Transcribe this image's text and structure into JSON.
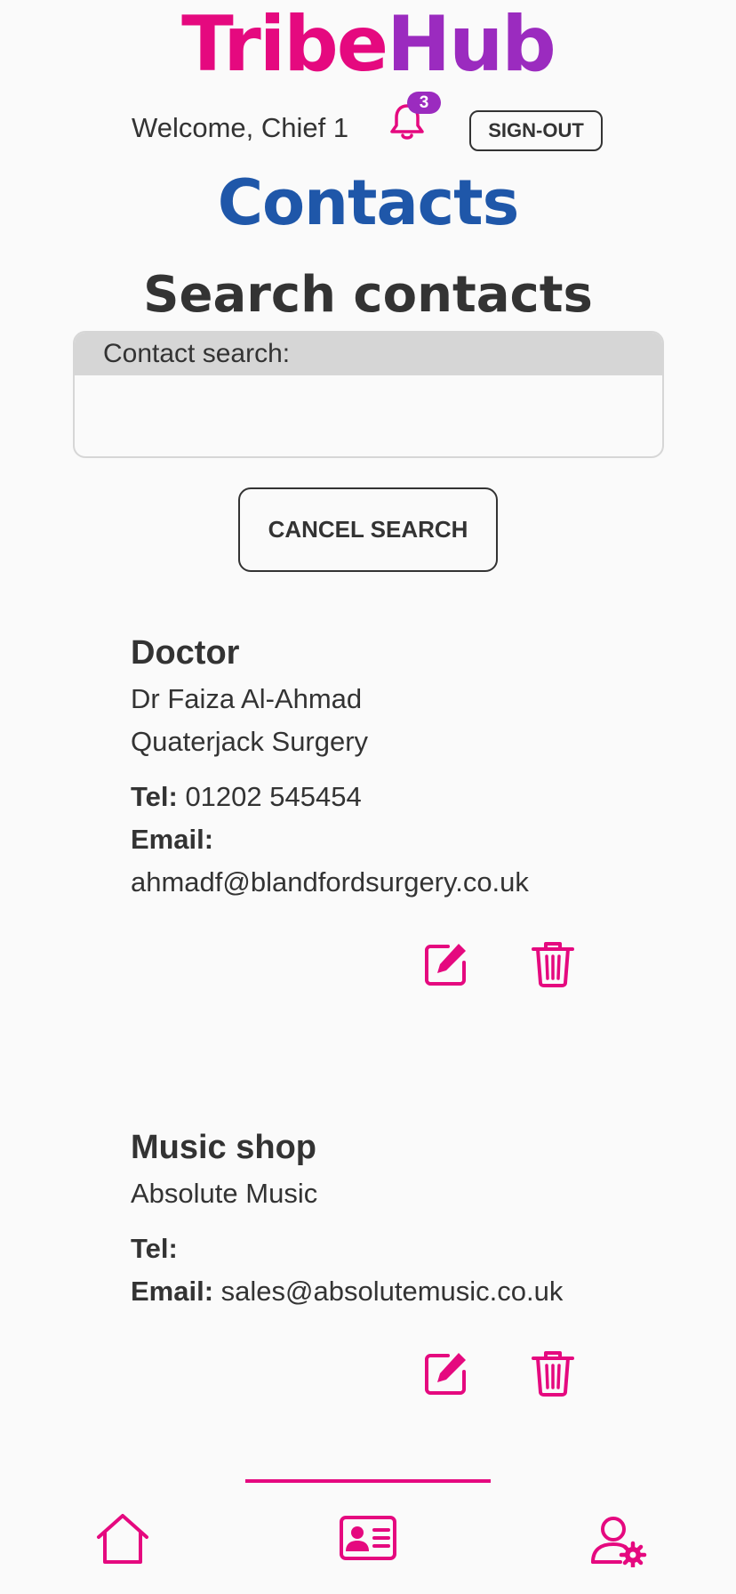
{
  "header": {
    "logo_part1": "Tribe",
    "logo_part2": "Hub",
    "welcome": "Welcome, Chief 1",
    "notification_count": "3",
    "signout_label": "SIGN-OUT"
  },
  "page": {
    "title": "Contacts",
    "subtitle": "Search contacts"
  },
  "search": {
    "label": "Contact search:",
    "value": "",
    "cancel_label": "CANCEL SEARCH"
  },
  "contacts": [
    {
      "category": "Doctor",
      "name": "Dr Faiza Al-Ahmad",
      "org": "Quaterjack Surgery",
      "tel_label": "Tel:",
      "tel": "01202 545454",
      "email_label": "Email:",
      "email": "ahmadf@blandfordsurgery.co.uk"
    },
    {
      "category": "Music shop",
      "org": "Absolute Music",
      "tel_label": "Tel:",
      "tel": "",
      "email_label": "Email:",
      "email": "sales@absolutemusic.co.uk"
    }
  ],
  "icons": {
    "notification": "bell-icon",
    "edit": "edit-icon",
    "delete": "trash-icon",
    "nav_home": "home-icon",
    "nav_contacts": "contact-card-icon",
    "nav_settings": "user-settings-icon"
  },
  "colors": {
    "brand_pink": "#e5097f",
    "brand_purple": "#9b2bbf",
    "title_blue": "#1f57a9",
    "text": "#333333",
    "background": "#fafafa"
  },
  "nav": {
    "active": "contacts"
  }
}
